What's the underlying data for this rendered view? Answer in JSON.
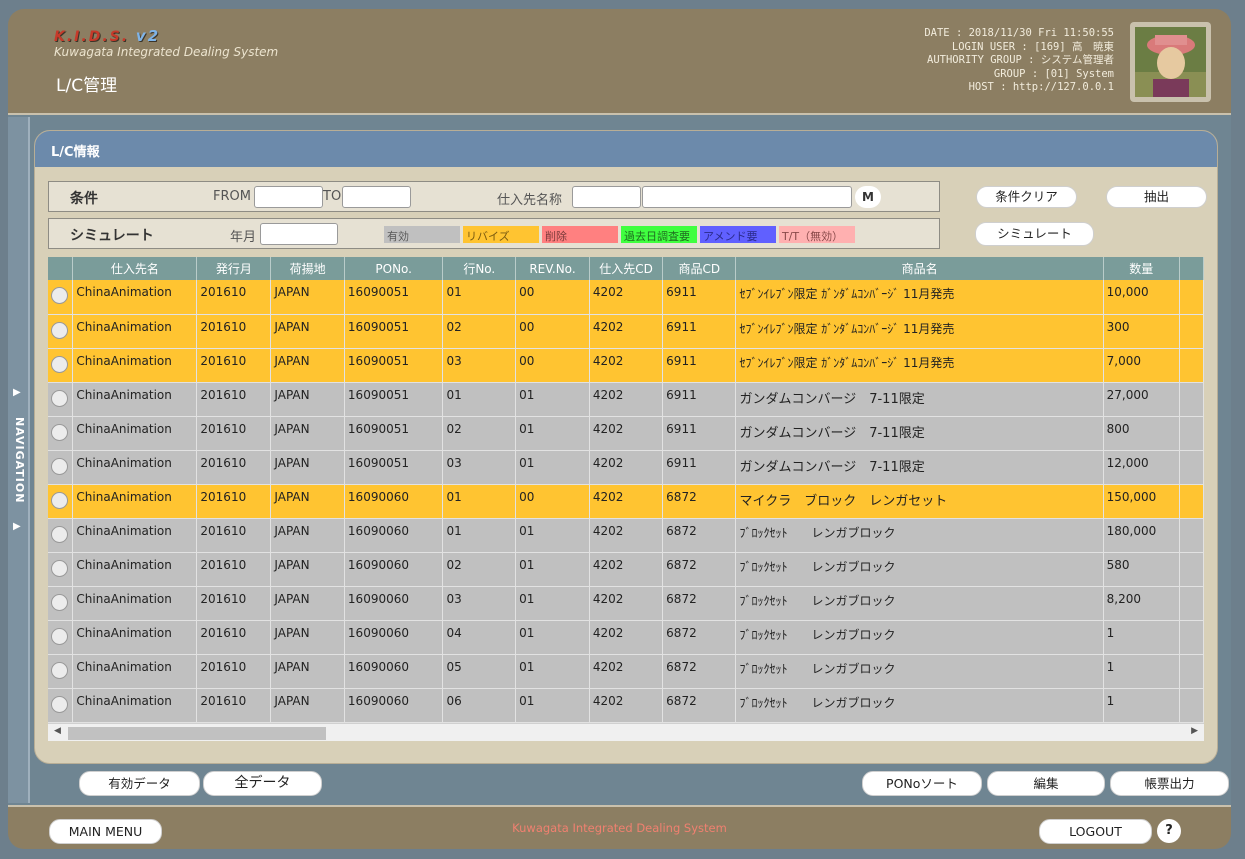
{
  "header": {
    "logo_title": "K.I.D.S.",
    "logo_version": "v2",
    "logo_subtitle": "Kuwagata Integrated Dealing System",
    "page_title": "L/C管理",
    "date_line": "DATE : 2018/11/30 Fri 11:50:55",
    "user_line": "LOGIN USER : [169] 高　暁東",
    "authority_line": "AUTHORITY GROUP : システム管理者",
    "group_line": "GROUP : [01] System",
    "host_line": "HOST : http://127.0.0.1"
  },
  "nav": {
    "label": "NAVIGATION"
  },
  "panel": {
    "title": "L/C情報"
  },
  "conditions": {
    "label": "条件",
    "from_label": "FROM",
    "to_label": "TO",
    "supplier_label": "仕入先名称",
    "m_button": "M",
    "from_value": "",
    "to_value": "",
    "supplier_code": "",
    "supplier_name": ""
  },
  "simulate": {
    "label": "シミュレート",
    "month_label": "年月",
    "month_value": ""
  },
  "legend": [
    {
      "label": "有効",
      "color": "#c0c0c0",
      "text_color": "#5a5a5a"
    },
    {
      "label": "リバイズ",
      "color": "#ffc431",
      "text_color": "#7a5a10"
    },
    {
      "label": "削除",
      "color": "#ff8080",
      "text_color": "#7a3a3a"
    },
    {
      "label": "過去日調査要",
      "color": "#40ff40",
      "text_color": "#1f6b1f"
    },
    {
      "label": "アメンド要",
      "color": "#6060ff",
      "text_color": "#2a2a8a"
    },
    {
      "label": "T/T（無効）",
      "color": "#ffb0b0",
      "text_color": "#8a4a4a"
    }
  ],
  "buttons": {
    "clear": "条件クリア",
    "extract": "抽出",
    "simulate": "シミュレート",
    "valid_data": "有効データ",
    "all_data": "全データ",
    "pono_sort": "PONoソート",
    "edit": "編集",
    "report": "帳票出力",
    "main_menu": "MAIN MENU",
    "logout": "LOGOUT",
    "help": "?"
  },
  "table": {
    "columns": [
      "仕入先名",
      "発行月",
      "荷揚地",
      "PONo.",
      "行No.",
      "REV.No.",
      "仕入先CD",
      "商品CD",
      "商品名",
      "数量"
    ],
    "rows": [
      {
        "status": "revise",
        "cells": [
          "ChinaAnimation",
          "201610",
          "JAPAN",
          "16090051",
          "01",
          "00",
          "4202",
          "6911",
          "ｾﾌﾞﾝｲﾚﾌﾞﾝ限定 ｶﾞﾝﾀﾞﾑｺﾝﾊﾞｰｼﾞ 11月発売",
          "10,000"
        ]
      },
      {
        "status": "revise",
        "cells": [
          "ChinaAnimation",
          "201610",
          "JAPAN",
          "16090051",
          "02",
          "00",
          "4202",
          "6911",
          "ｾﾌﾞﾝｲﾚﾌﾞﾝ限定 ｶﾞﾝﾀﾞﾑｺﾝﾊﾞｰｼﾞ 11月発売",
          "300"
        ]
      },
      {
        "status": "revise",
        "cells": [
          "ChinaAnimation",
          "201610",
          "JAPAN",
          "16090051",
          "03",
          "00",
          "4202",
          "6911",
          "ｾﾌﾞﾝｲﾚﾌﾞﾝ限定 ｶﾞﾝﾀﾞﾑｺﾝﾊﾞｰｼﾞ 11月発売",
          "7,000"
        ]
      },
      {
        "status": "valid",
        "cells": [
          "ChinaAnimation",
          "201610",
          "JAPAN",
          "16090051",
          "01",
          "01",
          "4202",
          "6911",
          "ガンダムコンバージ　7-11限定",
          "27,000"
        ]
      },
      {
        "status": "valid",
        "cells": [
          "ChinaAnimation",
          "201610",
          "JAPAN",
          "16090051",
          "02",
          "01",
          "4202",
          "6911",
          "ガンダムコンバージ　7-11限定",
          "800"
        ]
      },
      {
        "status": "valid",
        "cells": [
          "ChinaAnimation",
          "201610",
          "JAPAN",
          "16090051",
          "03",
          "01",
          "4202",
          "6911",
          "ガンダムコンバージ　7-11限定",
          "12,000"
        ]
      },
      {
        "status": "revise",
        "cells": [
          "ChinaAnimation",
          "201610",
          "JAPAN",
          "16090060",
          "01",
          "00",
          "4202",
          "6872",
          "マイクラ　ブロック　レンガセット",
          "150,000"
        ]
      },
      {
        "status": "valid",
        "cells": [
          "ChinaAnimation",
          "201610",
          "JAPAN",
          "16090060",
          "01",
          "01",
          "4202",
          "6872",
          "ﾌﾞﾛｯｸｾｯﾄ　　レンガブロック",
          "180,000"
        ]
      },
      {
        "status": "valid",
        "cells": [
          "ChinaAnimation",
          "201610",
          "JAPAN",
          "16090060",
          "02",
          "01",
          "4202",
          "6872",
          "ﾌﾞﾛｯｸｾｯﾄ　　レンガブロック",
          "580"
        ]
      },
      {
        "status": "valid",
        "cells": [
          "ChinaAnimation",
          "201610",
          "JAPAN",
          "16090060",
          "03",
          "01",
          "4202",
          "6872",
          "ﾌﾞﾛｯｸｾｯﾄ　　レンガブロック",
          "8,200"
        ]
      },
      {
        "status": "valid",
        "cells": [
          "ChinaAnimation",
          "201610",
          "JAPAN",
          "16090060",
          "04",
          "01",
          "4202",
          "6872",
          "ﾌﾞﾛｯｸｾｯﾄ　　レンガブロック",
          "1"
        ]
      },
      {
        "status": "valid",
        "cells": [
          "ChinaAnimation",
          "201610",
          "JAPAN",
          "16090060",
          "05",
          "01",
          "4202",
          "6872",
          "ﾌﾞﾛｯｸｾｯﾄ　　レンガブロック",
          "1"
        ]
      },
      {
        "status": "valid",
        "cells": [
          "ChinaAnimation",
          "201610",
          "JAPAN",
          "16090060",
          "06",
          "01",
          "4202",
          "6872",
          "ﾌﾞﾛｯｸｾｯﾄ　　レンガブロック",
          "1"
        ]
      }
    ]
  },
  "footer": {
    "text": "Kuwagata Integrated Dealing System"
  },
  "colors": {
    "header_bg": "#8c7e62",
    "panel_head": "#6c8aab",
    "row_revise": "#ffc431",
    "row_valid": "#c0c0c0",
    "table_head": "#7a9c9a"
  }
}
